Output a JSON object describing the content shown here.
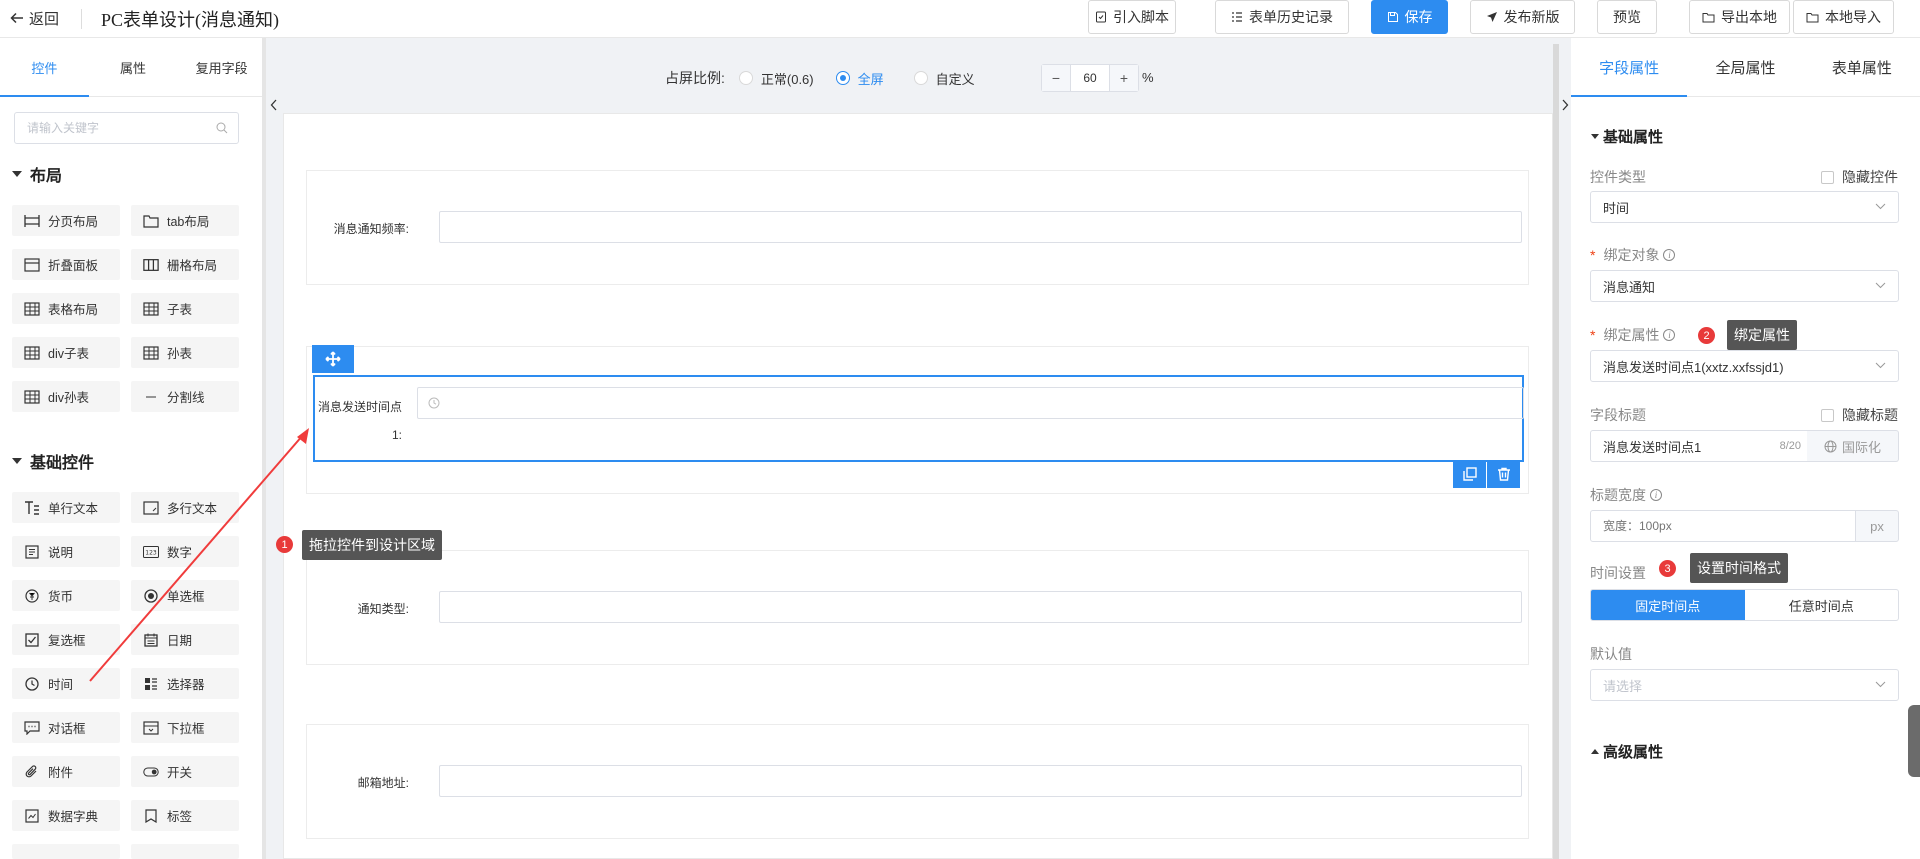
{
  "topbar": {
    "back_label": "返回",
    "title": "PC表单设计(消息通知)",
    "buttons": [
      {
        "label": "引入脚本",
        "icon": "script-icon"
      },
      {
        "label": "表单历史记录",
        "icon": "list-icon"
      },
      {
        "label": "保存",
        "icon": "save-icon"
      },
      {
        "label": "发布新版",
        "icon": "send-icon"
      },
      {
        "label": "预览",
        "icon": ""
      },
      {
        "label": "导出本地",
        "icon": "folder-icon"
      },
      {
        "label": "本地导入",
        "icon": "folder-icon"
      }
    ]
  },
  "left": {
    "tabs": [
      "控件",
      "属性",
      "复用字段"
    ],
    "active_tab": "控件",
    "search_placeholder": "请输入关键字",
    "layout_section": "布局",
    "layout_items": [
      {
        "label": "分页布局",
        "icon": "page-layout-icon"
      },
      {
        "label": "tab布局",
        "icon": "tab-layout-icon"
      },
      {
        "label": "折叠面板",
        "icon": "collapse-panel-icon"
      },
      {
        "label": "栅格布局",
        "icon": "grid-layout-icon"
      },
      {
        "label": "表格布局",
        "icon": "table-layout-icon"
      },
      {
        "label": "子表",
        "icon": "subtable-icon"
      },
      {
        "label": "div子表",
        "icon": "div-subtable-icon"
      },
      {
        "label": "孙表",
        "icon": "grandchild-table-icon"
      },
      {
        "label": "div孙表",
        "icon": "div-grandchild-table-icon"
      },
      {
        "label": "分割线",
        "icon": "divider-icon"
      }
    ],
    "basic_section": "基础控件",
    "basic_items": [
      {
        "label": "单行文本",
        "icon": "single-line-text-icon"
      },
      {
        "label": "多行文本",
        "icon": "multi-line-text-icon"
      },
      {
        "label": "说明",
        "icon": "description-icon"
      },
      {
        "label": "数字",
        "icon": "number-icon"
      },
      {
        "label": "货币",
        "icon": "currency-icon"
      },
      {
        "label": "单选框",
        "icon": "radio-icon"
      },
      {
        "label": "复选框",
        "icon": "checkbox-icon"
      },
      {
        "label": "日期",
        "icon": "calendar-icon"
      },
      {
        "label": "时间",
        "icon": "clock-icon"
      },
      {
        "label": "选择器",
        "icon": "selector-icon"
      },
      {
        "label": "对话框",
        "icon": "dialog-icon"
      },
      {
        "label": "下拉框",
        "icon": "dropdown-icon"
      },
      {
        "label": "附件",
        "icon": "attachment-icon"
      },
      {
        "label": "开关",
        "icon": "switch-icon"
      },
      {
        "label": "数据字典",
        "icon": "data-dictionary-icon"
      },
      {
        "label": "标签",
        "icon": "tag-icon"
      }
    ]
  },
  "center": {
    "ratio_label": "占屏比例:",
    "ratio_options": [
      "正常(0.6)",
      "全屏",
      "自定义"
    ],
    "ratio_selected": "全屏",
    "custom_value": "60",
    "percent": "%",
    "fields": [
      {
        "label": "消息通知频率:"
      },
      {
        "label": "消息发送时间点",
        "sub": "1:"
      },
      {
        "label": "通知类型:"
      },
      {
        "label": "邮箱地址:"
      }
    ],
    "annotation_1": {
      "num": "1",
      "text": "拖拉控件到设计区域"
    }
  },
  "right": {
    "tabs": [
      "字段属性",
      "全局属性",
      "表单属性"
    ],
    "active_tab": "字段属性",
    "basic_header": "基础属性",
    "control_type_label": "控件类型",
    "hide_control_label": "隐藏控件",
    "control_type_value": "时间",
    "bind_object_label": "绑定对象",
    "bind_object_value": "消息通知",
    "bind_attr_label": "绑定属性",
    "bind_attr_value": "消息发送时间点1(xxtz.xxfssjd1)",
    "annotation_2": {
      "num": "2",
      "text": "绑定属性"
    },
    "field_title_label": "字段标题",
    "hide_title_label": "隐藏标题",
    "field_title_value": "消息发送时间点1",
    "field_title_count": "8/20",
    "i18n_label": "国际化",
    "title_width_label": "标题宽度",
    "title_width_placeholder": "宽度：100px",
    "unit": "px",
    "time_setting_label": "时间设置",
    "annotation_3": {
      "num": "3",
      "text": "设置时间格式"
    },
    "time_modes": [
      "固定时间点",
      "任意时间点"
    ],
    "time_mode_selected": "固定时间点",
    "default_label": "默认值",
    "default_placeholder": "请选择",
    "advanced_header": "高级属性"
  },
  "colors": {
    "accent": "#2d8cf0",
    "badge": "#e83a3a",
    "arrow": "#f03c3c",
    "tooltip": "#555555"
  }
}
